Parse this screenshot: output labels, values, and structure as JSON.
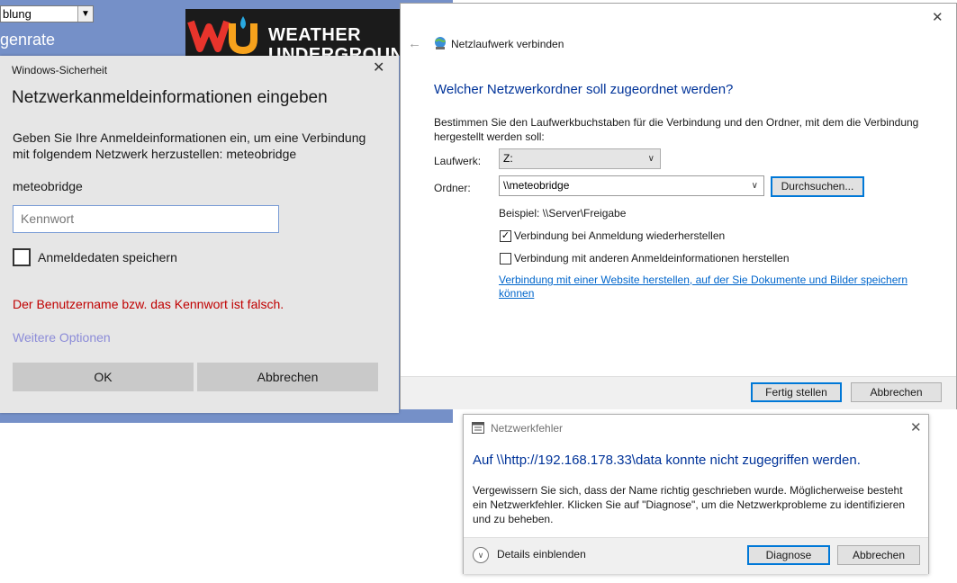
{
  "background_page": {
    "select_value": "blung",
    "heading": "genrate",
    "logo_text_1": "WEATHER",
    "logo_text_2": "UNDERGROUND"
  },
  "security_dialog": {
    "caption": "Windows-Sicherheit",
    "title": "Netzwerkanmeldeinformationen eingeben",
    "description": "Geben Sie Ihre Anmeldeinformationen ein, um eine Verbindung mit folgendem Netzwerk herzustellen: meteobridge",
    "username": "meteobridge",
    "password_placeholder": "Kennwort",
    "remember_label": "Anmeldedaten speichern",
    "error": "Der Benutzername bzw. das Kennwort ist falsch.",
    "more_options": "Weitere Optionen",
    "ok_label": "OK",
    "cancel_label": "Abbrechen"
  },
  "map_drive_wizard": {
    "window_title": "Netzlaufwerk verbinden",
    "heading": "Welcher Netzwerkordner soll zugeordnet werden?",
    "instruction": "Bestimmen Sie den Laufwerkbuchstaben für die Verbindung und den Ordner, mit dem die Verbindung hergestellt werden soll:",
    "drive_label": "Laufwerk:",
    "drive_value": "Z:",
    "folder_label": "Ordner:",
    "folder_value": "\\\\meteobridge",
    "browse_label": "Durchsuchen...",
    "example": "Beispiel: \\\\Server\\Freigabe",
    "reconnect_label": "Verbindung bei Anmeldung wiederherstellen",
    "reconnect_checked": true,
    "other_creds_label": "Verbindung mit anderen Anmeldeinformationen herstellen",
    "other_creds_checked": false,
    "website_link": "Verbindung mit einer Website herstellen, auf der Sie Dokumente und Bilder speichern können",
    "finish_label": "Fertig stellen",
    "cancel_label": "Abbrechen"
  },
  "network_error_dialog": {
    "caption": "Netzwerkfehler",
    "heading": "Auf \\\\http://192.168.178.33\\data konnte nicht zugegriffen werden.",
    "body": "Vergewissern Sie sich, dass der Name richtig geschrieben wurde. Möglicherweise besteht ein Netzwerkfehler. Klicken Sie auf \"Diagnose\", um die Netzwerkprobleme zu identifizieren und zu beheben.",
    "details_label": "Details einblenden",
    "diagnose_label": "Diagnose",
    "cancel_label": "Abbrechen"
  },
  "colors": {
    "background_band": "#7590c8",
    "heading_blue": "#003399",
    "error_red": "#c00000",
    "focus_blue": "#0078d7"
  }
}
